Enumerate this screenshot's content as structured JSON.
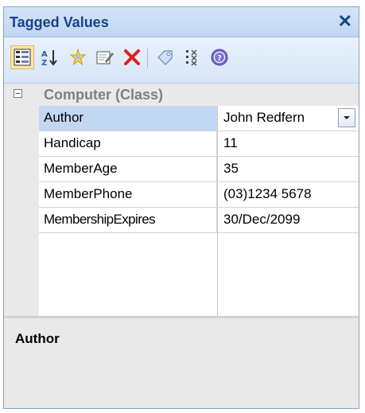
{
  "window": {
    "title": "Tagged Values",
    "close_icon": "✕"
  },
  "toolbar": {
    "buttons": [
      {
        "name": "categorized-view-icon",
        "active": true
      },
      {
        "name": "sort-alphabetical-icon",
        "active": false
      },
      {
        "name": "new-tag-icon",
        "active": false
      },
      {
        "name": "edit-note-icon",
        "active": false
      },
      {
        "name": "delete-icon",
        "active": false
      },
      {
        "name": "tag-icon",
        "active": false
      },
      {
        "name": "inherited-values-icon",
        "active": false
      },
      {
        "name": "help-icon",
        "active": false
      }
    ]
  },
  "grid": {
    "category": {
      "expander": "−",
      "label": "Computer (Class)"
    },
    "rows": [
      {
        "name": "Author",
        "value": "John Redfern",
        "selected": true
      },
      {
        "name": "Handicap",
        "value": "11"
      },
      {
        "name": "MemberAge",
        "value": "35"
      },
      {
        "name": "MemberPhone",
        "value": "(03)1234 5678"
      },
      {
        "name": "MembershipExpires",
        "value": "30/Dec/2099"
      }
    ]
  },
  "description": {
    "title": "Author"
  },
  "colors": {
    "title_text": "#15428b",
    "selection": "#c2d7f2",
    "delete_red": "#e02020"
  }
}
